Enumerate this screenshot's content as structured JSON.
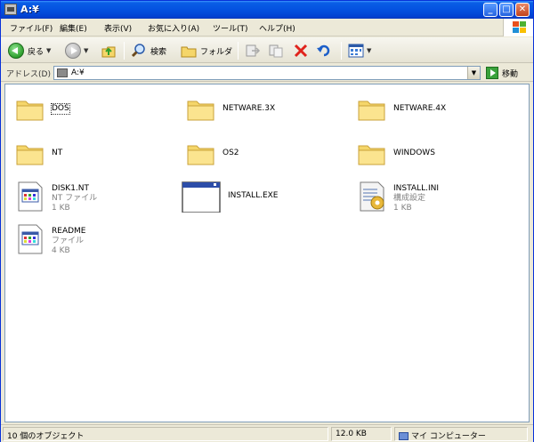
{
  "window": {
    "title": "A:¥",
    "controls": {
      "minimize": "_",
      "maximize": "□",
      "close": "✕"
    }
  },
  "menu": [
    "ファイル(F)",
    "編集(E)",
    "表示(V)",
    "お気に入り(A)",
    "ツール(T)",
    "ヘルプ(H)"
  ],
  "toolbar": {
    "back_label": "戻る",
    "search_label": "検索",
    "folders_label": "フォルダ"
  },
  "address": {
    "label": "アドレス(D)",
    "value": "A:¥",
    "go_label": "移動"
  },
  "items": [
    {
      "name": "DOS",
      "type": "folder"
    },
    {
      "name": "NETWARE.3X",
      "type": "folder"
    },
    {
      "name": "NETWARE.4X",
      "type": "folder"
    },
    {
      "name": "NT",
      "type": "folder"
    },
    {
      "name": "OS2",
      "type": "folder"
    },
    {
      "name": "WINDOWS",
      "type": "folder"
    },
    {
      "name": "DISK1.NT",
      "type_label": "NT ファイル",
      "size": "1 KB",
      "icon": "document-icon"
    },
    {
      "name": "INSTALL.EXE",
      "icon": "exe-window-icon"
    },
    {
      "name": "INSTALL.INI",
      "type_label": "構成設定",
      "size": "1 KB",
      "icon": "settings-file-icon"
    },
    {
      "name": "README",
      "type_label": "ファイル",
      "size": "4 KB",
      "icon": "document-icon"
    }
  ],
  "status": {
    "count": "10 個のオブジェクト",
    "size": "12.0 KB",
    "location": "マイ コンピューター"
  },
  "colors": {
    "titlebar": "#0451e0",
    "folder": "#f5d66a",
    "content_bg": "#ffffff",
    "chrome": "#ece9d8"
  }
}
